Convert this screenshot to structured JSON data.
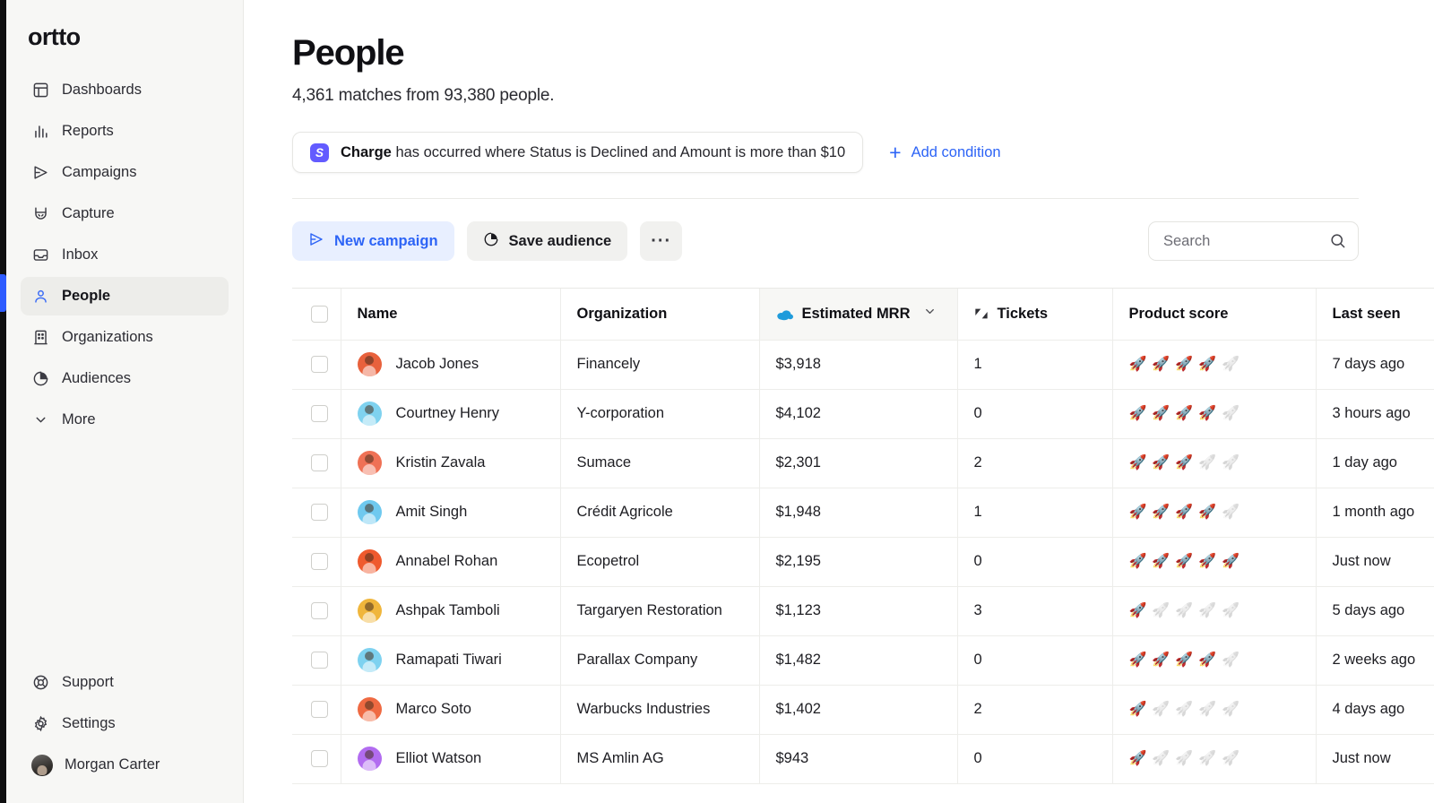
{
  "brand": {
    "logo": "ortto",
    "accent": "#2d64f6",
    "active_bar": "#2d5bff"
  },
  "sidebar": {
    "items": [
      {
        "label": "Dashboards",
        "icon": "dashboard-icon",
        "active": false
      },
      {
        "label": "Reports",
        "icon": "bar-chart-icon",
        "active": false
      },
      {
        "label": "Campaigns",
        "icon": "send-icon",
        "active": false
      },
      {
        "label": "Capture",
        "icon": "magnet-icon",
        "active": false
      },
      {
        "label": "Inbox",
        "icon": "inbox-icon",
        "active": false
      },
      {
        "label": "People",
        "icon": "person-icon",
        "active": true
      },
      {
        "label": "Organizations",
        "icon": "building-icon",
        "active": false
      },
      {
        "label": "Audiences",
        "icon": "pie-chart-icon",
        "active": false
      },
      {
        "label": "More",
        "icon": "chevron-down-icon",
        "active": false
      }
    ],
    "bottom": [
      {
        "label": "Support",
        "icon": "lifebuoy-icon"
      },
      {
        "label": "Settings",
        "icon": "gear-icon"
      }
    ],
    "user": {
      "name": "Morgan Carter",
      "icon": "avatar"
    }
  },
  "header": {
    "title": "People",
    "subtitle": "4,361 matches from 93,380 people.",
    "condition": {
      "source_icon": "stripe-icon",
      "source_letter": "S",
      "bold_text": "Charge",
      "rest_text": " has occurred where Status is Declined and Amount is more than $10"
    },
    "add_condition": {
      "label": "Add condition",
      "icon": "plus-icon"
    }
  },
  "toolbar": {
    "new_campaign": {
      "label": "New campaign",
      "icon": "send-icon"
    },
    "save_audience": {
      "label": "Save audience",
      "icon": "pie-chart-icon"
    },
    "more": {
      "label": "···",
      "icon": "ellipsis-icon"
    },
    "search": {
      "placeholder": "Search",
      "value": "",
      "icon": "search-icon"
    }
  },
  "table": {
    "columns": [
      {
        "key": "select",
        "label": "",
        "icon": "checkbox-icon"
      },
      {
        "key": "name",
        "label": "Name",
        "icon": null
      },
      {
        "key": "organization",
        "label": "Organization",
        "icon": null
      },
      {
        "key": "mrr",
        "label": "Estimated MRR",
        "icon": "salesforce-cloud-icon",
        "sorted": true,
        "sort_icon": "chevron-down-icon"
      },
      {
        "key": "tickets",
        "label": "Tickets",
        "icon": "zendesk-icon"
      },
      {
        "key": "product_score",
        "label": "Product score",
        "icon": null
      },
      {
        "key": "last_seen",
        "label": "Last seen",
        "icon": null
      }
    ],
    "score_max": 5,
    "score_glyph": "🚀",
    "rows": [
      {
        "name": "Jacob Jones",
        "organization": "Financely",
        "mrr": "$3,918",
        "tickets": "1",
        "product_score": 4,
        "last_seen": "7 days ago",
        "avatar_color": "#e8613c"
      },
      {
        "name": "Courtney Henry",
        "organization": "Y-corporation",
        "mrr": "$4,102",
        "tickets": "0",
        "product_score": 4,
        "last_seen": "3 hours ago",
        "avatar_color": "#7fd2ef"
      },
      {
        "name": "Kristin Zavala",
        "organization": "Sumace",
        "mrr": "$2,301",
        "tickets": "2",
        "product_score": 3,
        "last_seen": "1 day ago",
        "avatar_color": "#ef7155"
      },
      {
        "name": "Amit Singh",
        "organization": "Crédit Agricole",
        "mrr": "$1,948",
        "tickets": "1",
        "product_score": 4,
        "last_seen": "1 month ago",
        "avatar_color": "#6fc9ef"
      },
      {
        "name": "Annabel Rohan",
        "organization": "Ecopetrol",
        "mrr": "$2,195",
        "tickets": "0",
        "product_score": 5,
        "last_seen": "Just now",
        "avatar_color": "#ef5a2e"
      },
      {
        "name": "Ashpak Tamboli",
        "organization": "Targaryen Restoration",
        "mrr": "$1,123",
        "tickets": "3",
        "product_score": 1,
        "last_seen": "5 days ago",
        "avatar_color": "#f0b63c"
      },
      {
        "name": "Ramapati Tiwari",
        "organization": "Parallax Company",
        "mrr": "$1,482",
        "tickets": "0",
        "product_score": 4,
        "last_seen": "2 weeks ago",
        "avatar_color": "#7ed2f0"
      },
      {
        "name": "Marco Soto",
        "organization": "Warbucks Industries",
        "mrr": "$1,402",
        "tickets": "2",
        "product_score": 1,
        "last_seen": "4 days ago",
        "avatar_color": "#ef6a42"
      },
      {
        "name": "Elliot Watson",
        "organization": "MS Amlin AG",
        "mrr": "$943",
        "tickets": "0",
        "product_score": 1,
        "last_seen": "Just now",
        "avatar_color": "#b26cf0"
      }
    ]
  }
}
